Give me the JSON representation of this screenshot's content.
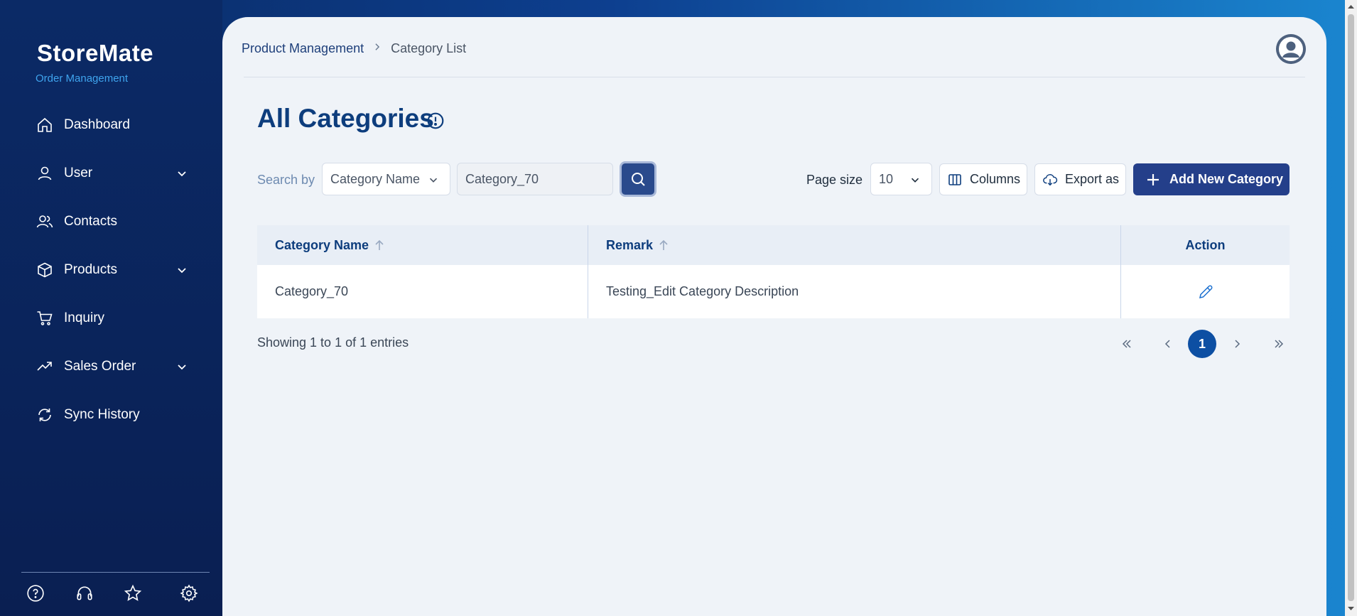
{
  "app": {
    "logo_text": "StoreMate",
    "logo_sub": "Order Management"
  },
  "sidebar": {
    "items": [
      {
        "label": "Dashboard",
        "icon": "home-icon",
        "has_submenu": false
      },
      {
        "label": "User",
        "icon": "user-icon",
        "has_submenu": true
      },
      {
        "label": "Contacts",
        "icon": "contacts-icon",
        "has_submenu": false
      },
      {
        "label": "Products",
        "icon": "box-icon",
        "has_submenu": true
      },
      {
        "label": "Inquiry",
        "icon": "cart-icon",
        "has_submenu": false
      },
      {
        "label": "Sales Order",
        "icon": "trend-up-icon",
        "has_submenu": true
      },
      {
        "label": "Sync History",
        "icon": "sync-icon",
        "has_submenu": false
      }
    ],
    "footer_icons": [
      "help-icon",
      "headset-icon",
      "star-icon",
      "gear-icon"
    ]
  },
  "header": {
    "breadcrumb": [
      "Product Management",
      "Category List"
    ]
  },
  "page": {
    "title": "All Categories"
  },
  "toolbar": {
    "search_by_label": "Search by",
    "search_field": "Category Name",
    "search_value": "Category_70",
    "page_size_label": "Page size",
    "page_size_value": "10",
    "columns_label": "Columns",
    "export_label": "Export as",
    "add_label": "Add New Category"
  },
  "table": {
    "columns": [
      "Category Name",
      "Remark",
      "Action"
    ],
    "rows": [
      {
        "category_name": "Category_70",
        "remark": "Testing_Edit Category Description"
      }
    ]
  },
  "footer": {
    "entries_text": "Showing 1 to 1 of 1 entries",
    "current_page": "1"
  },
  "colors": {
    "primary": "#243f8a",
    "title": "#0d3d7d",
    "sidebar_bg": "#0b2a66",
    "accent": "#3fa4ee"
  }
}
